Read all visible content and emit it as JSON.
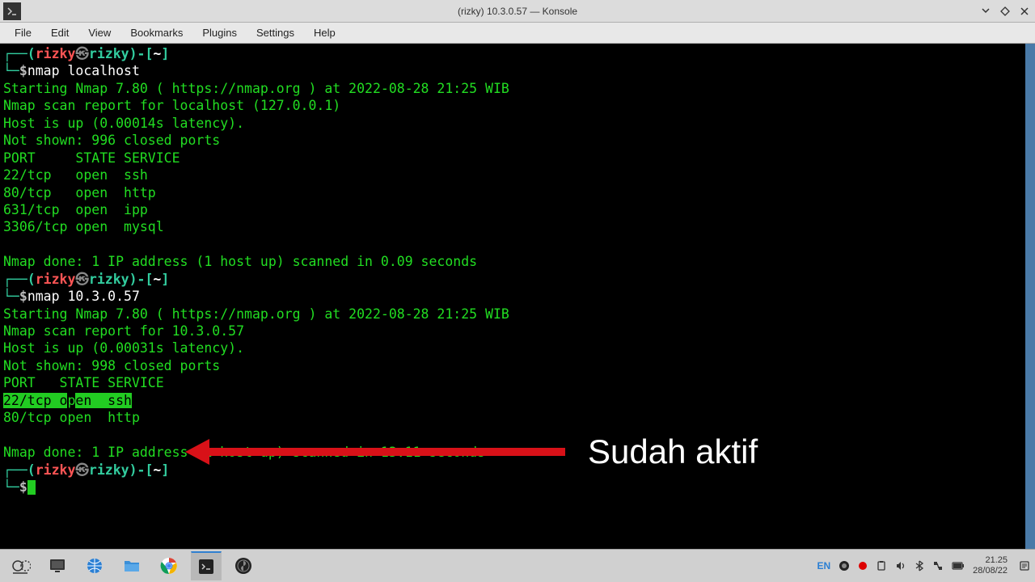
{
  "window": {
    "title": "(rizky) 10.3.0.57 — Konsole"
  },
  "menubar": {
    "items": [
      "File",
      "Edit",
      "View",
      "Bookmarks",
      "Plugins",
      "Settings",
      "Help"
    ]
  },
  "terminal": {
    "prompt1_user": "rizky",
    "prompt1_host": "rizky",
    "prompt1_path": "~",
    "cmd1": "nmap localhost",
    "out1_l1": "Starting Nmap 7.80 ( https://nmap.org ) at 2022-08-28 21:25 WIB",
    "out1_l2": "Nmap scan report for localhost (127.0.0.1)",
    "out1_l3": "Host is up (0.00014s latency).",
    "out1_l4": "Not shown: 996 closed ports",
    "out1_l5": "PORT     STATE SERVICE",
    "out1_l6": "22/tcp   open  ssh",
    "out1_l7": "80/tcp   open  http",
    "out1_l8": "631/tcp  open  ipp",
    "out1_l9": "3306/tcp open  mysql",
    "out1_l10": "Nmap done: 1 IP address (1 host up) scanned in 0.09 seconds",
    "prompt2_user": "rizky",
    "prompt2_host": "rizky",
    "prompt2_path": "~",
    "cmd2": "nmap 10.3.0.57",
    "out2_l1": "Starting Nmap 7.80 ( https://nmap.org ) at 2022-08-28 21:25 WIB",
    "out2_l2": "Nmap scan report for 10.3.0.57",
    "out2_l3": "Host is up (0.00031s latency).",
    "out2_l4": "Not shown: 998 closed ports",
    "out2_l5": "PORT   STATE SERVICE",
    "out2_hl_a": "22/tcp o",
    "out2_hl_b": "p",
    "out2_hl_c": "en  ssh",
    "out2_l7": "80/tcp open  http",
    "out2_l8": "Nmap done: 1 IP address (1 host up) scanned in 13.11 seconds",
    "prompt3_user": "rizky",
    "prompt3_host": "rizky",
    "prompt3_path": "~"
  },
  "annotation": {
    "text": "Sudah aktif"
  },
  "taskbar": {
    "lang": "EN",
    "time": "21.25",
    "date": "28/08/22"
  }
}
